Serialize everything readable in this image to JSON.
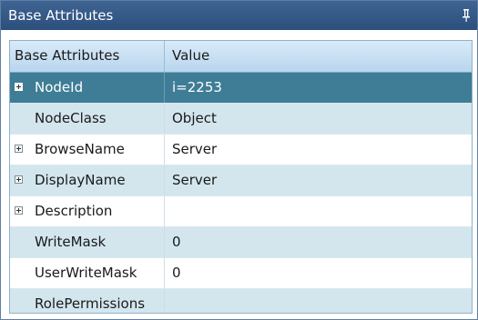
{
  "panel": {
    "title": "Base Attributes",
    "pin_icon": "pin-icon"
  },
  "grid": {
    "columns": [
      "Base Attributes",
      "Value"
    ],
    "rows": [
      {
        "name": "NodeId",
        "value": "i=2253",
        "expandable": true,
        "selected": true
      },
      {
        "name": "NodeClass",
        "value": "Object",
        "expandable": false
      },
      {
        "name": "BrowseName",
        "value": "Server",
        "expandable": true
      },
      {
        "name": "DisplayName",
        "value": "Server",
        "expandable": true
      },
      {
        "name": "Description",
        "value": "",
        "expandable": true
      },
      {
        "name": "WriteMask",
        "value": "0",
        "expandable": false
      },
      {
        "name": "UserWriteMask",
        "value": "0",
        "expandable": false
      },
      {
        "name": "RolePermissions",
        "value": "",
        "expandable": false
      }
    ]
  },
  "colors": {
    "title_bar": "#2c4f7c",
    "selected_row": "#3e7d95",
    "alt_row": "#d3e6ee"
  }
}
